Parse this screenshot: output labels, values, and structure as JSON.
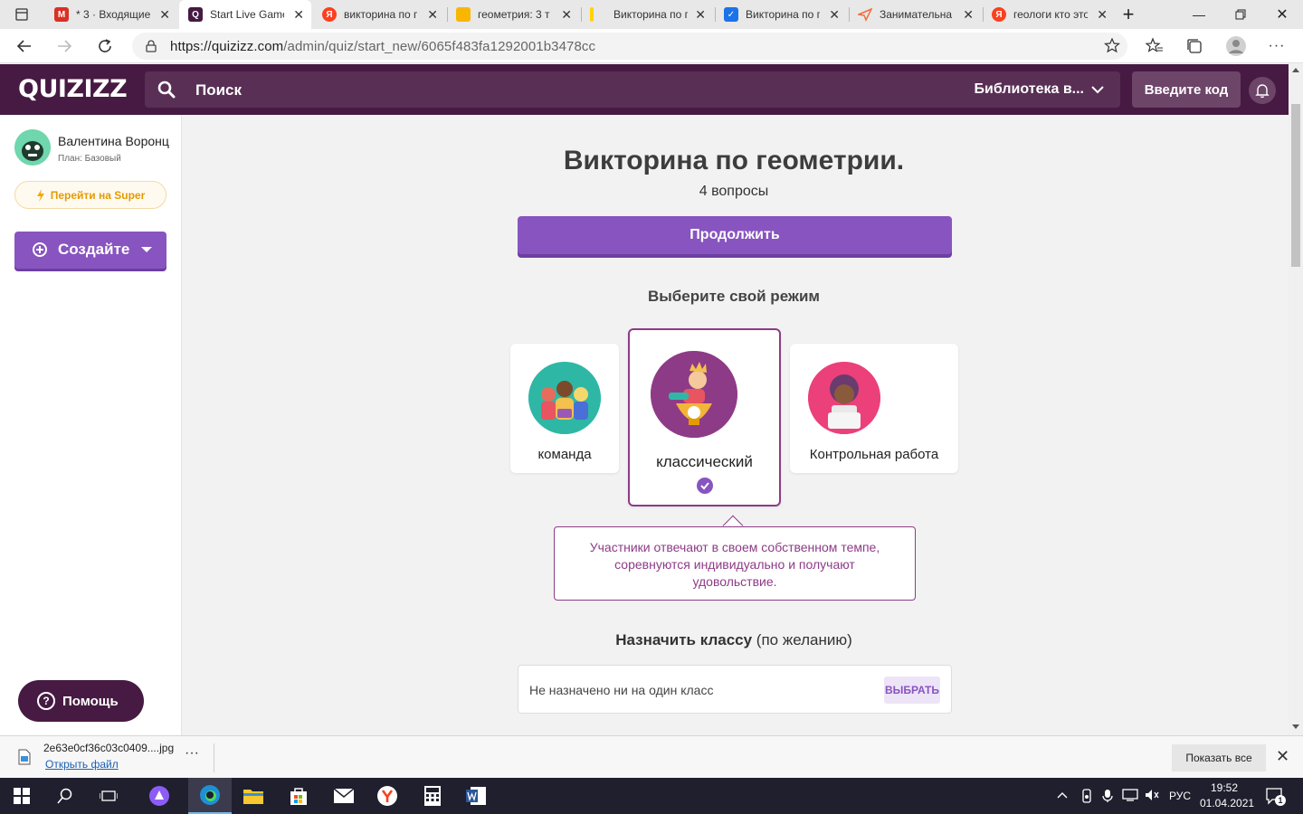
{
  "browser": {
    "tabs": [
      {
        "title": "* 3 · Входящие -",
        "icon": "mail-icon",
        "color": "#d93025"
      },
      {
        "title": "Start Live Game",
        "icon": "quizizz-icon",
        "color": "#461a42"
      },
      {
        "title": "викторина по г",
        "icon": "yandex-icon",
        "color": "#fc3f1d"
      },
      {
        "title": "геометрия: 3 т",
        "icon": "folder-icon",
        "color": "#f9b600"
      },
      {
        "title": "Викторина по г",
        "icon": "yellow-bar-icon",
        "color": "#ffd400"
      },
      {
        "title": "Викторина по г",
        "icon": "check-icon",
        "color": "#1a73e8"
      },
      {
        "title": "Занимательна",
        "icon": "paper-plane-icon",
        "color": "#f26b3a"
      },
      {
        "title": "геологи кто это",
        "icon": "yandex-icon",
        "color": "#fc3f1d"
      }
    ],
    "url_host": "https://quizizz.com",
    "url_path": "/admin/quiz/start_new/6065f483fa1292001b3478cc"
  },
  "header": {
    "logo": "QUIZIZZ",
    "search_placeholder": "Поиск",
    "library": "Библиотека в...",
    "join_code": "Введите код"
  },
  "sidebar": {
    "user_name": "Валентина Воронц",
    "plan": "План: Базовый",
    "upgrade": "Перейти на Super",
    "create": "Создайте",
    "help": "Помощь"
  },
  "main": {
    "title": "Викторина по геометрии.",
    "question_count": "4 вопросы",
    "continue": "Продолжить",
    "mode_heading": "Выберите свой режим",
    "modes": [
      {
        "label": "команда",
        "selected": false
      },
      {
        "label": "классический",
        "selected": true
      },
      {
        "label": "Контрольная работа",
        "selected": false
      }
    ],
    "mode_description": "Участники отвечают в своем собственном темпе, соревнуются индивидуально и получают удовольствие.",
    "assign_heading_bold": "Назначить классу",
    "assign_heading_rest": " (по желанию)",
    "assign_value": "Не назначено ни на один класс",
    "assign_button": "ВЫБРАТЬ"
  },
  "download": {
    "filename": "2e63e0cf36c03c0409....jpg",
    "open": "Открыть файл",
    "show_all": "Показать все"
  },
  "taskbar": {
    "lang": "РУС",
    "time": "19:52",
    "date": "01.04.2021",
    "notifications": "1"
  },
  "colors": {
    "brand": "#461a42",
    "accent": "#8854c0",
    "selected_border": "#8e3b87"
  }
}
